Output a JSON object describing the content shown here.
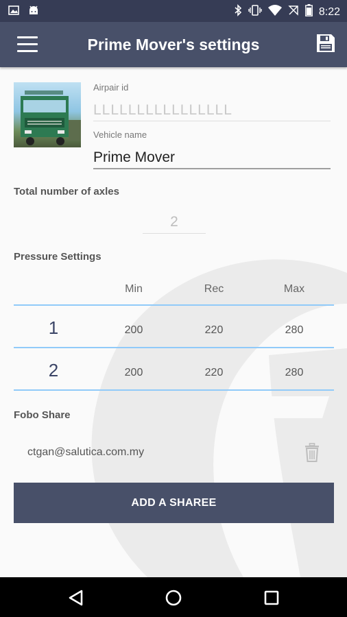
{
  "status_bar": {
    "time": "8:22",
    "left_icons": [
      "image-icon",
      "android-icon"
    ],
    "right_icons": [
      "bluetooth-icon",
      "vibrate-icon",
      "wifi-icon",
      "no-sim-icon",
      "battery-icon"
    ]
  },
  "app_bar": {
    "title": "Prime Mover's settings",
    "menu_icon": "hamburger-menu-icon",
    "save_icon": "floppy-save-icon"
  },
  "vehicle": {
    "airpair_label": "Airpair id",
    "airpair_value": "LLLLLLLLLLLLLLLL",
    "name_label": "Vehicle name",
    "name_value": "Prime Mover",
    "thumbnail_icon": "truck-thumbnail"
  },
  "axles": {
    "label": "Total number of axles",
    "value": "2"
  },
  "pressure": {
    "label": "Pressure Settings",
    "headers": [
      "Min",
      "Rec",
      "Max"
    ],
    "rows": [
      {
        "axle": "1",
        "min": "200",
        "rec": "220",
        "max": "280"
      },
      {
        "axle": "2",
        "min": "200",
        "rec": "220",
        "max": "280"
      }
    ]
  },
  "share": {
    "label": "Fobo Share",
    "sharees": [
      {
        "email": "ctgan@salutica.com.my",
        "delete_icon": "trash-icon"
      }
    ],
    "add_button": "ADD A SHAREE"
  },
  "colors": {
    "app_bar": "#485069",
    "status_bar": "#363c55",
    "table_line": "#90caf9",
    "button": "#485069"
  }
}
